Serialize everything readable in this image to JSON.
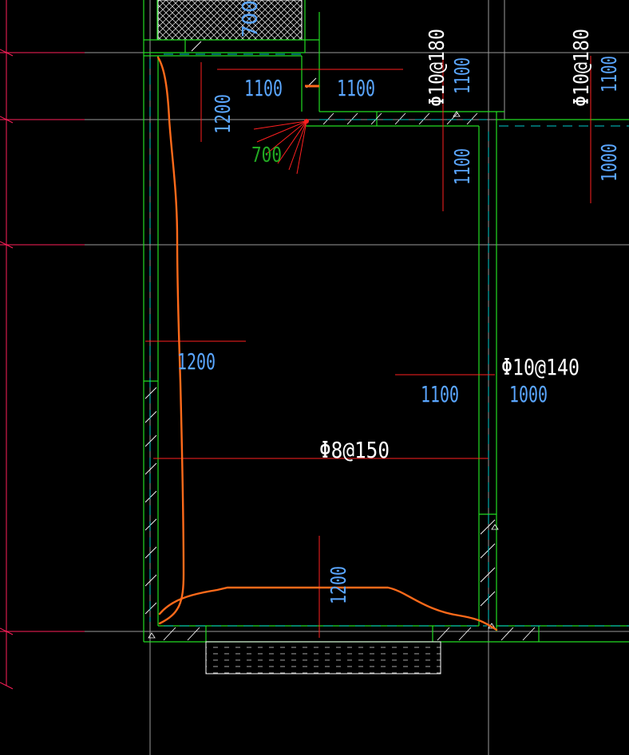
{
  "drawing": {
    "background": "#000000",
    "colors": {
      "grid_line": "#9a9a9a",
      "axis_line": "#ff1f5a",
      "wall": "#22dd22",
      "dimension": "#5aa6ff",
      "rebar_line": "#ff2020",
      "sketch": "#ff6a1a",
      "label": "#ffffff",
      "hidden_line": "#00cccc",
      "green_text": "#22aa22"
    },
    "labels": {
      "top_strip": "700",
      "dim_1100_a": "1100",
      "dim_1100_b": "1100",
      "dim_1200_vertical": "1200",
      "corner_700": "700",
      "rebar_phi10_at180_a": "Φ10@180",
      "dim_1100_vertical_a": "1100",
      "rebar_phi10_at180_b": "Φ10@180",
      "dim_1100_vertical_b": "1100",
      "dim_1100_vertical_c": "1100",
      "dim_1000_vertical": "1000",
      "dim_1200_mid": "1200",
      "rebar_phi10_at140": "Φ10@140",
      "dim_1100_mid": "1100",
      "dim_1000_mid": "1000",
      "rebar_phi8_at150": "Φ8@150",
      "dim_1200_bottom": "1200"
    }
  }
}
